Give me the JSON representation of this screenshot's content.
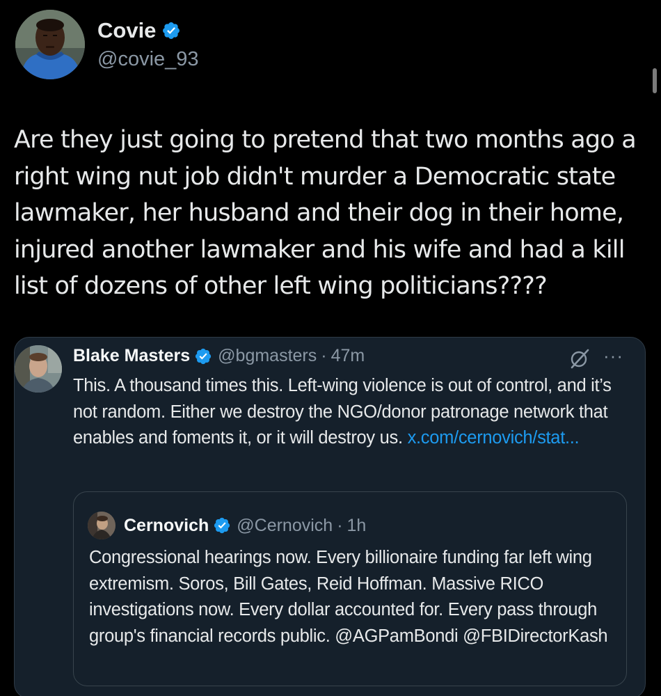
{
  "main_tweet": {
    "author": {
      "display_name": "Covie",
      "handle": "@covie_93",
      "verified": true
    },
    "text": "Are they just going to pretend that two months ago a right wing nut job didn't murder a Democratic state lawmaker, her husband and their dog in their home, injured another lawmaker and his wife and had a kill list of dozens of other left wing politicians????"
  },
  "quoted_tweet": {
    "author": {
      "display_name": "Blake Masters",
      "handle": "@bgmasters",
      "separator": "·",
      "time": "47m",
      "verified": true
    },
    "text": "This. A thousand times this. Left-wing violence is out of control, and it’s not random. Either we destroy the NGO/donor patronage network that enables and foments it, or it will destroy us.",
    "link": "x.com/cernovich/stat...",
    "more_label": "···",
    "icons": [
      "grok-icon",
      "more-icon"
    ]
  },
  "nested_quote": {
    "author": {
      "display_name": "Cernovich",
      "handle": "@Cernovich",
      "separator": "·",
      "time": "1h",
      "verified": true
    },
    "text": "Congressional hearings now. Every billionaire funding far left wing extremism. Soros, Bill Gates, Reid Hoffman. Massive RICO investigations now. Every dollar accounted for. Every pass through group's financial records public. @AGPamBondi @FBIDirectorKash"
  },
  "colors": {
    "background": "#000000",
    "card_background": "#15202b",
    "text_primary": "#e7e9ea",
    "text_secondary": "#8b98a5",
    "link": "#1d9bf0",
    "verified_badge": "#1d9bf0"
  }
}
